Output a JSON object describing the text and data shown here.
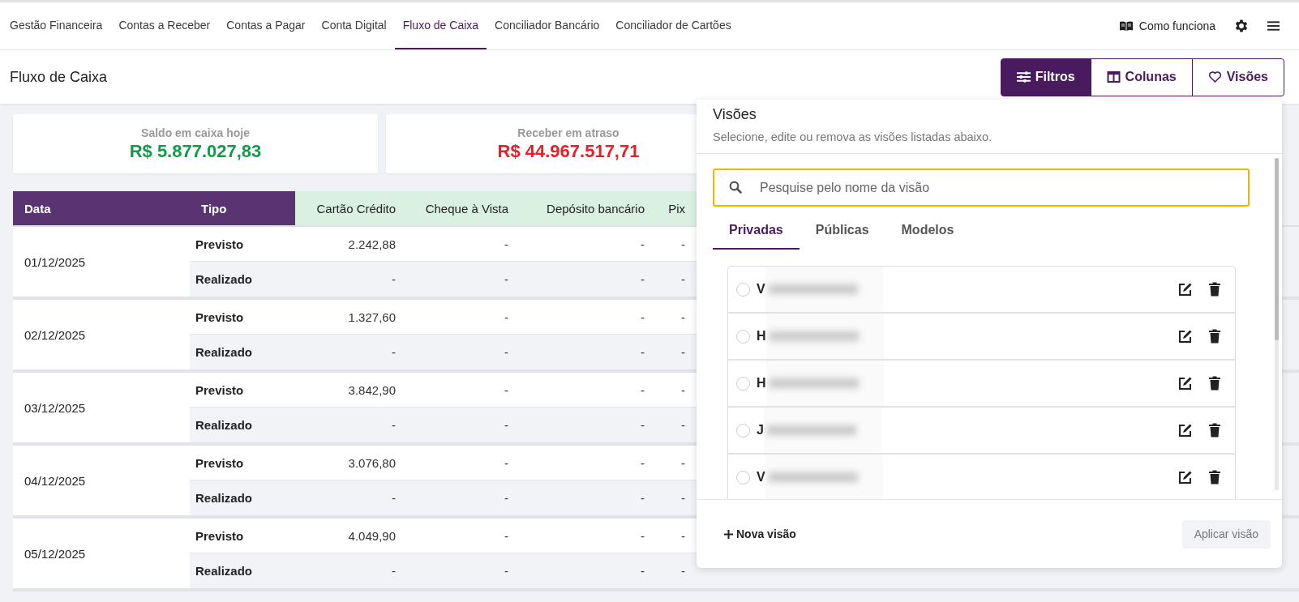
{
  "nav": {
    "tabs": [
      {
        "label": "Gestão Financeira",
        "selected": false
      },
      {
        "label": "Contas a Receber",
        "selected": false
      },
      {
        "label": "Contas a Pagar",
        "selected": false
      },
      {
        "label": "Conta Digital",
        "selected": false
      },
      {
        "label": "Fluxo de Caixa",
        "selected": true
      },
      {
        "label": "Conciliador Bancário",
        "selected": false
      },
      {
        "label": "Conciliador de Cartões",
        "selected": false
      }
    ],
    "help": "Como funciona"
  },
  "header": {
    "title": "Fluxo de Caixa",
    "buttons": [
      {
        "label": "Filtros",
        "kind": "sliders",
        "selected": true
      },
      {
        "label": "Colunas",
        "kind": "columns",
        "selected": false
      },
      {
        "label": "Visões",
        "kind": "heart",
        "selected": false
      }
    ]
  },
  "summary": [
    {
      "label": "Saldo em caixa hoje",
      "value": "R$ 5.877.027,83",
      "color": "#0f9d49"
    },
    {
      "label": "Receber em atraso",
      "value": "R$ 44.967.517,71",
      "color": "#ee1c25"
    }
  ],
  "table": {
    "columns": [
      {
        "label": "Data",
        "kind": "key"
      },
      {
        "label": "Tipo",
        "kind": "key"
      },
      {
        "label": "Cartão Crédito",
        "kind": "value"
      },
      {
        "label": "Cheque à Vista",
        "kind": "value"
      },
      {
        "label": "Depósito bancário",
        "kind": "value"
      },
      {
        "label": "Pix",
        "kind": "value"
      }
    ],
    "groups": [
      {
        "date": "01/12/2025",
        "rows": [
          {
            "type": "Previsto",
            "values": [
              "2.242,88",
              "-",
              "-",
              "-"
            ]
          },
          {
            "type": "Realizado",
            "values": [
              "-",
              "-",
              "-",
              "-"
            ]
          }
        ]
      },
      {
        "date": "02/12/2025",
        "rows": [
          {
            "type": "Previsto",
            "values": [
              "1.327,60",
              "-",
              "-",
              "-"
            ]
          },
          {
            "type": "Realizado",
            "values": [
              "-",
              "-",
              "-",
              "-"
            ]
          }
        ]
      },
      {
        "date": "03/12/2025",
        "rows": [
          {
            "type": "Previsto",
            "values": [
              "3.842,90",
              "-",
              "-",
              "-"
            ]
          },
          {
            "type": "Realizado",
            "values": [
              "-",
              "-",
              "-",
              "-"
            ]
          }
        ]
      },
      {
        "date": "04/12/2025",
        "rows": [
          {
            "type": "Previsto",
            "values": [
              "3.076,80",
              "-",
              "-",
              "-"
            ]
          },
          {
            "type": "Realizado",
            "values": [
              "-",
              "-",
              "-",
              "-"
            ]
          }
        ]
      },
      {
        "date": "05/12/2025",
        "rows": [
          {
            "type": "Previsto",
            "values": [
              "4.049,90",
              "-",
              "-",
              "-"
            ]
          },
          {
            "type": "Realizado",
            "values": [
              "-",
              "-",
              "-",
              "-"
            ]
          }
        ]
      }
    ]
  },
  "panel": {
    "title": "Visões",
    "subtitle": "Selecione, edite ou remova as visões listadas abaixo.",
    "search": {
      "placeholder": "Pesquise pelo nome da visão"
    },
    "tabs": [
      {
        "label": "Privadas",
        "selected": true
      },
      {
        "label": "Públicas",
        "selected": false
      },
      {
        "label": "Modelos",
        "selected": false
      }
    ],
    "views": [
      {
        "name": "V",
        "selected": false
      },
      {
        "name": "H",
        "selected": false
      },
      {
        "name": "H",
        "selected": false
      },
      {
        "name": "J",
        "selected": false
      },
      {
        "name": "V",
        "selected": false
      }
    ],
    "new_button": "Nova visão",
    "apply_button": {
      "label": "Aplicar visão",
      "disabled": true
    }
  }
}
